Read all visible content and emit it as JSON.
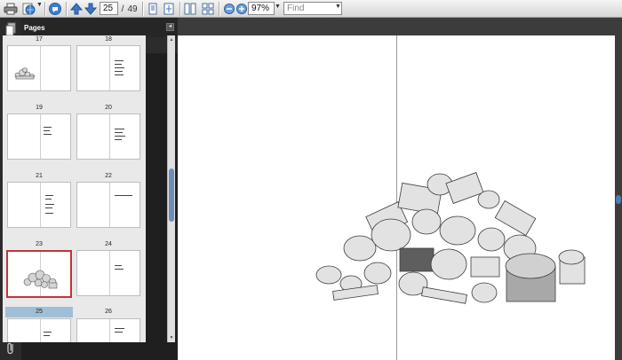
{
  "toolbar": {
    "current_page": "25",
    "page_separator": "/",
    "total_pages": "49",
    "zoom": "97%",
    "find_placeholder": "Find"
  },
  "panel": {
    "title": "Pages"
  },
  "thumbnails": [
    {
      "number": "17"
    },
    {
      "number": "18"
    },
    {
      "number": "19"
    },
    {
      "number": "20"
    },
    {
      "number": "21"
    },
    {
      "number": "22"
    },
    {
      "number": "23"
    },
    {
      "number": "24"
    },
    {
      "number": "25"
    },
    {
      "number": "26"
    }
  ],
  "colors": {
    "selection_border": "#c0343c",
    "selection_highlight": "#9fbfd7",
    "scroll_thumb": "#6d8fb7"
  }
}
